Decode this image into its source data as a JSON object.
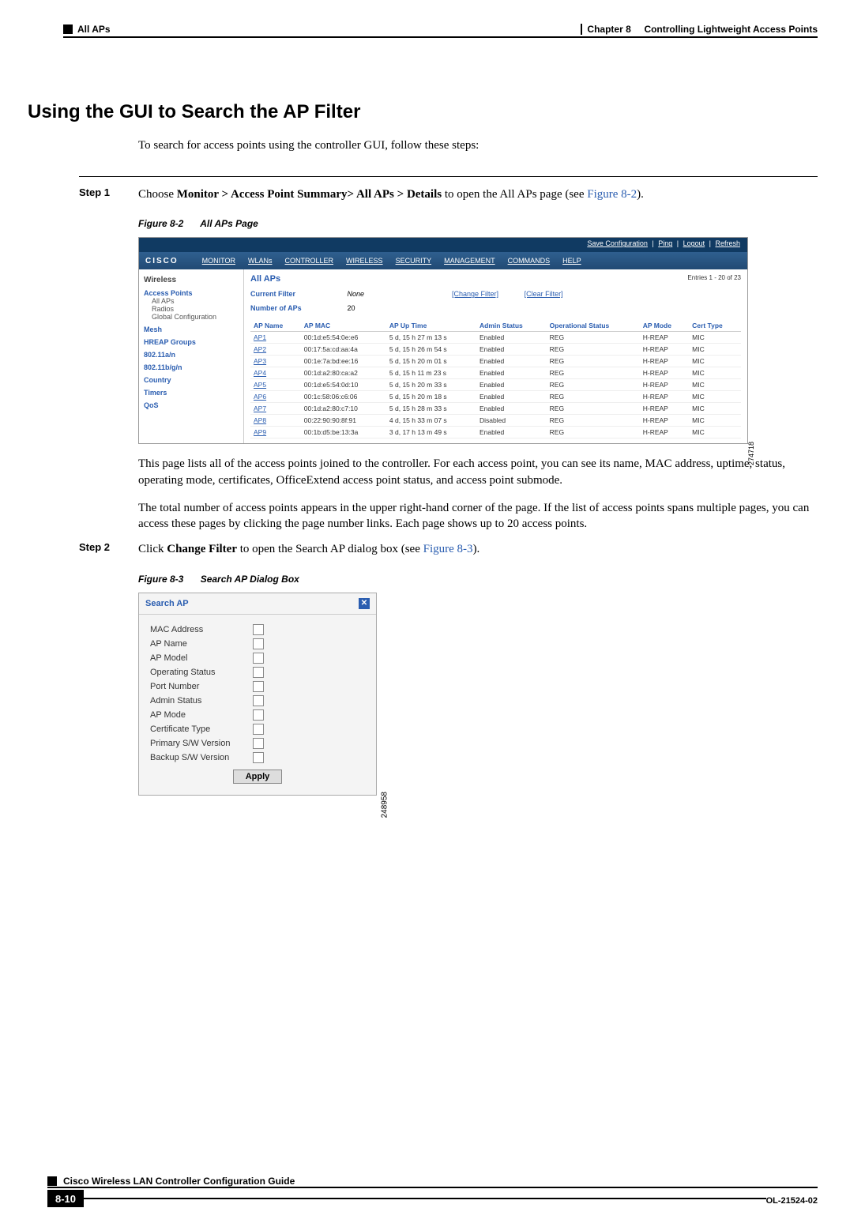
{
  "header": {
    "section_label": "All APs",
    "chapter": "Chapter 8",
    "chapter_title": "Controlling Lightweight Access Points"
  },
  "heading": "Using the GUI to Search the AP Filter",
  "intro": "To search for access points using the controller GUI, follow these steps:",
  "step1": {
    "label": "Step 1",
    "text_prefix": "Choose ",
    "bold_path": "Monitor > Access Point Summary> All APs > Details",
    "text_mid": " to open the All APs page (see ",
    "fig_ref": "Figure 8-2",
    "text_suffix": ")."
  },
  "fig82_caption_num": "Figure 8-2",
  "fig82_caption_title": "All APs Page",
  "fig82": {
    "topbar": {
      "save": "Save Configuration",
      "ping": "Ping",
      "logout": "Logout",
      "refresh": "Refresh"
    },
    "logo": "CISCO",
    "nav": [
      "MONITOR",
      "WLANs",
      "CONTROLLER",
      "WIRELESS",
      "SECURITY",
      "MANAGEMENT",
      "COMMANDS",
      "HELP"
    ],
    "sidebar": {
      "title": "Wireless",
      "access_points": "Access Points",
      "all_aps": "All APs",
      "radios": "Radios",
      "global_cfg": "Global Configuration",
      "mesh": "Mesh",
      "hreap": "HREAP Groups",
      "band_a": "802.11a/n",
      "band_b": "802.11b/g/n",
      "country": "Country",
      "timers": "Timers",
      "qos": "QoS"
    },
    "page_title": "All APs",
    "entries": "Entries 1 - 20 of 23",
    "current_filter_label": "Current Filter",
    "current_filter_value": "None",
    "change_filter": "[Change Filter]",
    "clear_filter": "[Clear Filter]",
    "num_aps_label": "Number of APs",
    "num_aps_value": "20",
    "columns": [
      "AP Name",
      "AP MAC",
      "AP Up Time",
      "Admin Status",
      "Operational Status",
      "AP Mode",
      "Cert Type"
    ],
    "rows": [
      {
        "name": "AP1",
        "mac": "00:1d:e5:54:0e:e6",
        "up": "5 d, 15 h 27 m 13 s",
        "admin": "Enabled",
        "op": "REG",
        "mode": "H-REAP",
        "cert": "MIC"
      },
      {
        "name": "AP2",
        "mac": "00:17:5a:cd:aa:4a",
        "up": "5 d, 15 h 26 m 54 s",
        "admin": "Enabled",
        "op": "REG",
        "mode": "H-REAP",
        "cert": "MIC"
      },
      {
        "name": "AP3",
        "mac": "00:1e:7a:bd:ee:16",
        "up": "5 d, 15 h 20 m 01 s",
        "admin": "Enabled",
        "op": "REG",
        "mode": "H-REAP",
        "cert": "MIC"
      },
      {
        "name": "AP4",
        "mac": "00:1d:a2:80:ca:a2",
        "up": "5 d, 15 h 11 m 23 s",
        "admin": "Enabled",
        "op": "REG",
        "mode": "H-REAP",
        "cert": "MIC"
      },
      {
        "name": "AP5",
        "mac": "00:1d:e5:54:0d:10",
        "up": "5 d, 15 h 20 m 33 s",
        "admin": "Enabled",
        "op": "REG",
        "mode": "H-REAP",
        "cert": "MIC"
      },
      {
        "name": "AP6",
        "mac": "00:1c:58:06:c6:06",
        "up": "5 d, 15 h 20 m 18 s",
        "admin": "Enabled",
        "op": "REG",
        "mode": "H-REAP",
        "cert": "MIC"
      },
      {
        "name": "AP7",
        "mac": "00:1d:a2:80:c7:10",
        "up": "5 d, 15 h 28 m 33 s",
        "admin": "Enabled",
        "op": "REG",
        "mode": "H-REAP",
        "cert": "MIC"
      },
      {
        "name": "AP8",
        "mac": "00:22:90:90:8f:91",
        "up": "4 d, 15 h 33 m 07 s",
        "admin": "Disabled",
        "op": "REG",
        "mode": "H-REAP",
        "cert": "MIC"
      },
      {
        "name": "AP9",
        "mac": "00:1b:d5:be:13:3a",
        "up": "3 d, 17 h 13 m 49 s",
        "admin": "Enabled",
        "op": "REG",
        "mode": "H-REAP",
        "cert": "MIC"
      }
    ],
    "side_number": "274718"
  },
  "para1": "This page lists all of the access points joined to the controller. For each access point, you can see its name, MAC address, uptime, status, operating mode, certificates, OfficeExtend access point status, and access point submode.",
  "para2": "The total number of access points appears in the upper right-hand corner of the page. If the list of access points spans multiple pages, you can access these pages by clicking the page number links. Each page shows up to 20 access points.",
  "step2": {
    "label": "Step 2",
    "text_prefix": "Click ",
    "bold": "Change Filter",
    "text_mid": " to open the Search AP dialog box (see ",
    "fig_ref": "Figure 8-3",
    "text_suffix": ")."
  },
  "fig83_caption_num": "Figure 8-3",
  "fig83_caption_title": "Search AP Dialog Box",
  "fig83": {
    "title": "Search AP",
    "fields": [
      "MAC Address",
      "AP Name",
      "AP Model",
      "Operating Status",
      "Port Number",
      "Admin Status",
      "AP Mode",
      "Certificate Type",
      "Primary S/W Version",
      "Backup S/W Version"
    ],
    "apply": "Apply",
    "side_number": "248958"
  },
  "footer": {
    "book_title": "Cisco Wireless LAN Controller Configuration Guide",
    "page_number": "8-10",
    "doc_id": "OL-21524-02"
  }
}
